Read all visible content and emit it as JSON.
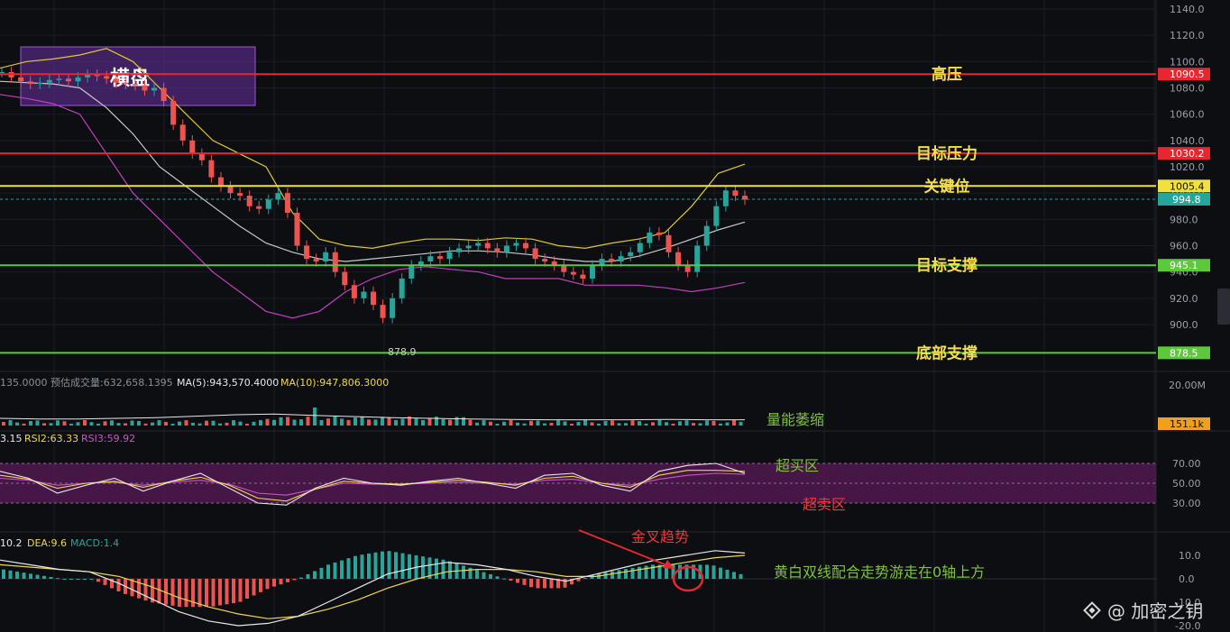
{
  "price_axis": {
    "ticks": [
      "1140.0",
      "1120.0",
      "1100.0",
      "1080.0",
      "1060.0",
      "1040.0",
      "1020.0",
      "1000.0",
      "980.0",
      "960.0",
      "940.0",
      "920.0",
      "900.0"
    ]
  },
  "levels": [
    {
      "price": 1090.5,
      "tag": "1090.5",
      "label": "高压",
      "color": "#e8262f",
      "text_color": "#f5e04a"
    },
    {
      "price": 1030.2,
      "tag": "1030.2",
      "label": "目标压力",
      "color": "#e8262f",
      "text_color": "#f5e04a"
    },
    {
      "price": 1005.4,
      "tag": "1005.4",
      "label": "关键位",
      "color": "#f0e040",
      "text_color": "#f5e04a"
    },
    {
      "price": 945.1,
      "tag": "945.1",
      "label": "目标支撑",
      "color": "#5cc93b",
      "text_color": "#f5e04a"
    },
    {
      "price": 878.5,
      "tag": "878.5",
      "label": "底部支撑",
      "color": "#5cc93b",
      "text_color": "#f5e04a"
    }
  ],
  "current_price": {
    "tag": "994.8",
    "color": "#26a69a"
  },
  "low_marker": "878.9",
  "consolidation_label": "横盘",
  "volume_panel": {
    "stats": [
      {
        "text": "135.0000",
        "color": "#8a8f98"
      },
      {
        "text": "预估成交量:632,658.1395",
        "color": "#8a8f98"
      },
      {
        "text": "MA(5):943,570.4000",
        "color": "#e8e8e8"
      },
      {
        "text": "MA(10):947,806.3000",
        "color": "#f0d84a"
      }
    ],
    "axis_top": "20.00M",
    "current_tag": "151.1k",
    "annotation": "量能萎缩"
  },
  "rsi_panel": {
    "stats": [
      {
        "text": "3.15",
        "color": "#e8e8e8"
      },
      {
        "text": "RSI2:63.33",
        "color": "#f0d84a"
      },
      {
        "text": "RSI3:59.92",
        "color": "#c855c8"
      }
    ],
    "ticks": [
      "70.00",
      "50.00",
      "30.00"
    ],
    "overbought_label": "超买区",
    "oversold_label": "超卖区"
  },
  "macd_panel": {
    "stats": [
      {
        "text": "10.2",
        "color": "#e8e8e8"
      },
      {
        "text": "DEA:9.6",
        "color": "#f0d84a"
      },
      {
        "text": "MACD:1.4",
        "color": "#26a69a"
      }
    ],
    "ticks": [
      "10.0",
      "0.0",
      "-10.0",
      "-20.0"
    ],
    "golden_cross_label": "金叉趋势",
    "note": "黄白双线配合走势游走在0轴上方"
  },
  "watermark": "@ 加密之钥",
  "chart_data": {
    "type": "candlestick",
    "price_range": [
      880,
      1145
    ],
    "close_series": [
      1092,
      1088,
      1085,
      1083,
      1084,
      1086,
      1087,
      1085,
      1088,
      1090,
      1089,
      1087,
      1084,
      1083,
      1082,
      1078,
      1080,
      1070,
      1052,
      1040,
      1030,
      1025,
      1012,
      1005,
      1000,
      998,
      990,
      988,
      995,
      1000,
      985,
      960,
      950,
      948,
      955,
      940,
      930,
      920,
      925,
      915,
      905,
      920,
      935,
      945,
      948,
      952,
      950,
      955,
      958,
      960,
      962,
      958,
      955,
      960,
      962,
      958,
      950,
      948,
      945,
      940,
      938,
      935,
      945,
      950,
      948,
      952,
      955,
      962,
      970,
      968,
      955,
      945,
      940,
      960,
      975,
      990,
      1002,
      998,
      995
    ],
    "bollinger": {
      "upper": [
        1095,
        1100,
        1102,
        1105,
        1110,
        1100,
        1080,
        1060,
        1040,
        1030,
        1020,
        985,
        965,
        960,
        958,
        962,
        965,
        965,
        964,
        966,
        965,
        960,
        958,
        962,
        965,
        970,
        990,
        1015,
        1022
      ],
      "middle": [
        1085,
        1084,
        1083,
        1080,
        1065,
        1045,
        1020,
        1005,
        990,
        975,
        962,
        955,
        950,
        948,
        950,
        952,
        954,
        956,
        956,
        955,
        953,
        950,
        948,
        948,
        952,
        958,
        965,
        972,
        978
      ],
      "lower": [
        1075,
        1072,
        1068,
        1060,
        1030,
        1000,
        980,
        960,
        940,
        925,
        910,
        905,
        910,
        925,
        935,
        942,
        944,
        942,
        940,
        935,
        935,
        935,
        930,
        930,
        930,
        928,
        925,
        928,
        932
      ]
    },
    "volume_ma": [
      20,
      18,
      18,
      20,
      22,
      26,
      30,
      32,
      28,
      25,
      22,
      20,
      18,
      17,
      16,
      16,
      16,
      17,
      16,
      16
    ],
    "rsi": {
      "bands": [
        70,
        50,
        30
      ],
      "rsi1": [
        62,
        55,
        40,
        48,
        55,
        42,
        52,
        60,
        45,
        30,
        28,
        45,
        55,
        50,
        48,
        52,
        55,
        50,
        45,
        58,
        60,
        48,
        42,
        62,
        68,
        70,
        60
      ],
      "rsi2": [
        58,
        54,
        45,
        50,
        52,
        46,
        52,
        56,
        48,
        35,
        32,
        44,
        52,
        50,
        49,
        51,
        53,
        51,
        48,
        55,
        57,
        50,
        46,
        58,
        63,
        63,
        62
      ],
      "rsi3": [
        55,
        53,
        48,
        50,
        51,
        48,
        51,
        53,
        49,
        40,
        38,
        44,
        50,
        49,
        49,
        50,
        51,
        50,
        49,
        53,
        54,
        50,
        48,
        54,
        58,
        60,
        59
      ]
    },
    "macd": {
      "dif": [
        8,
        6,
        4,
        3,
        -2,
        -8,
        -14,
        -18,
        -20,
        -19,
        -16,
        -10,
        -4,
        2,
        5,
        7,
        6,
        4,
        1,
        -1,
        2,
        5,
        8,
        10,
        12,
        11
      ],
      "dea": [
        6,
        5,
        4,
        3,
        1,
        -3,
        -8,
        -12,
        -15,
        -17,
        -16,
        -13,
        -9,
        -4,
        0,
        3,
        4,
        4,
        3,
        1,
        1,
        3,
        5,
        7,
        9,
        10
      ]
    }
  }
}
